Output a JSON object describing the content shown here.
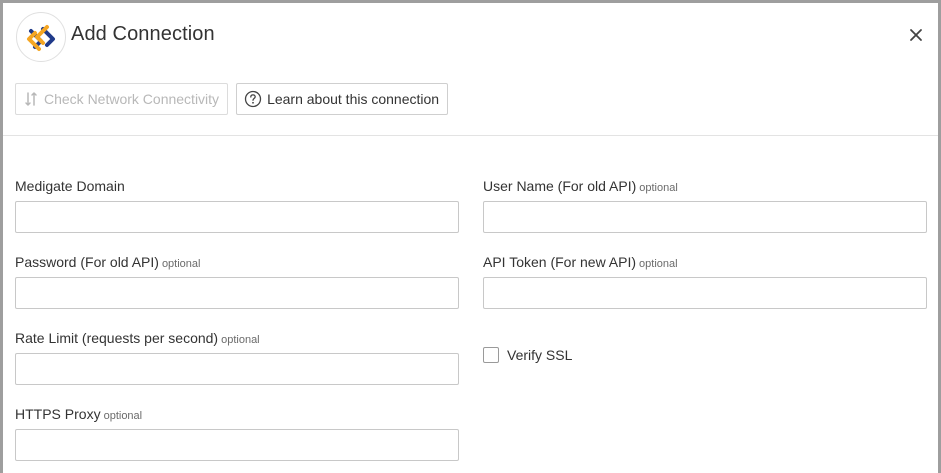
{
  "dialog": {
    "title": "Add Connection",
    "logo_icon": "connector-logo-icon",
    "close_icon": "close-icon"
  },
  "toolbar": {
    "check_network_label": "Check Network Connectivity",
    "learn_label": "Learn about this connection"
  },
  "form": {
    "optional_text": "optional",
    "medigate_domain": {
      "label": "Medigate Domain",
      "value": ""
    },
    "user_name": {
      "label": "User Name (For old API)",
      "value": ""
    },
    "password": {
      "label": "Password (For old API)",
      "value": ""
    },
    "api_token": {
      "label": "API Token (For new API)",
      "value": ""
    },
    "rate_limit": {
      "label": "Rate Limit (requests per second)",
      "value": ""
    },
    "verify_ssl": {
      "label": "Verify SSL",
      "checked": false
    },
    "https_proxy": {
      "label": "HTTPS Proxy",
      "value": ""
    }
  },
  "colors": {
    "logo_blue": "#1f3a8a",
    "logo_orange": "#f5a623",
    "disabled_text": "#b8b8b8",
    "text": "#333333"
  }
}
